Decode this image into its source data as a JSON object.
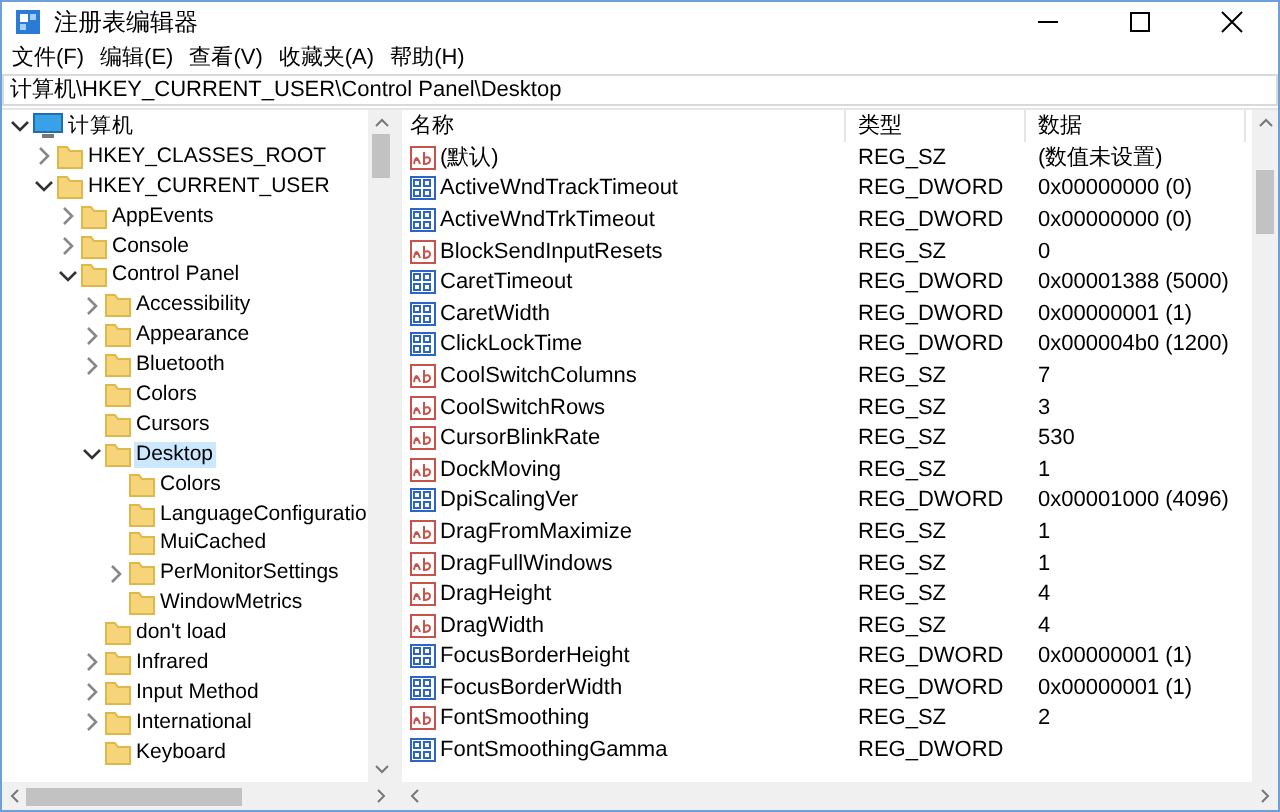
{
  "window": {
    "title": "注册表编辑器"
  },
  "menu": [
    "文件(F)",
    "编辑(E)",
    "查看(V)",
    "收藏夹(A)",
    "帮助(H)"
  ],
  "address": "计算机\\HKEY_CURRENT_USER\\Control Panel\\Desktop",
  "tree": [
    {
      "label": "计算机",
      "kind": "computer",
      "has_children": true,
      "expanded": true,
      "selected": false,
      "children": [
        {
          "label": "HKEY_CLASSES_ROOT",
          "kind": "folder",
          "has_children": true,
          "expanded": false,
          "selected": false
        },
        {
          "label": "HKEY_CURRENT_USER",
          "kind": "folder",
          "has_children": true,
          "expanded": true,
          "selected": false,
          "children": [
            {
              "label": "AppEvents",
              "kind": "folder",
              "has_children": true,
              "expanded": false,
              "selected": false
            },
            {
              "label": "Console",
              "kind": "folder",
              "has_children": true,
              "expanded": false,
              "selected": false
            },
            {
              "label": "Control Panel",
              "kind": "folder",
              "has_children": true,
              "expanded": true,
              "selected": false,
              "children": [
                {
                  "label": "Accessibility",
                  "kind": "folder",
                  "has_children": true,
                  "expanded": false,
                  "selected": false
                },
                {
                  "label": "Appearance",
                  "kind": "folder",
                  "has_children": true,
                  "expanded": false,
                  "selected": false
                },
                {
                  "label": "Bluetooth",
                  "kind": "folder",
                  "has_children": true,
                  "expanded": false,
                  "selected": false
                },
                {
                  "label": "Colors",
                  "kind": "folder",
                  "has_children": false,
                  "expanded": false,
                  "selected": false
                },
                {
                  "label": "Cursors",
                  "kind": "folder",
                  "has_children": false,
                  "expanded": false,
                  "selected": false
                },
                {
                  "label": "Desktop",
                  "kind": "folder",
                  "has_children": true,
                  "expanded": true,
                  "selected": true,
                  "children": [
                    {
                      "label": "Colors",
                      "kind": "folder",
                      "has_children": false,
                      "expanded": false,
                      "selected": false
                    },
                    {
                      "label": "LanguageConfiguratio",
                      "kind": "folder",
                      "has_children": false,
                      "expanded": false,
                      "selected": false
                    },
                    {
                      "label": "MuiCached",
                      "kind": "folder",
                      "has_children": false,
                      "expanded": false,
                      "selected": false
                    },
                    {
                      "label": "PerMonitorSettings",
                      "kind": "folder",
                      "has_children": true,
                      "expanded": false,
                      "selected": false
                    },
                    {
                      "label": "WindowMetrics",
                      "kind": "folder",
                      "has_children": false,
                      "expanded": false,
                      "selected": false
                    }
                  ]
                },
                {
                  "label": "don't load",
                  "kind": "folder",
                  "has_children": false,
                  "expanded": false,
                  "selected": false
                },
                {
                  "label": "Infrared",
                  "kind": "folder",
                  "has_children": true,
                  "expanded": false,
                  "selected": false
                },
                {
                  "label": "Input Method",
                  "kind": "folder",
                  "has_children": true,
                  "expanded": false,
                  "selected": false
                },
                {
                  "label": "International",
                  "kind": "folder",
                  "has_children": true,
                  "expanded": false,
                  "selected": false
                },
                {
                  "label": "Keyboard",
                  "kind": "folder",
                  "has_children": false,
                  "expanded": false,
                  "selected": false
                }
              ]
            }
          ]
        }
      ]
    }
  ],
  "table": {
    "columns": [
      "名称",
      "类型",
      "数据"
    ],
    "rows": [
      {
        "kind": "string",
        "name": "(默认)",
        "type": "REG_SZ",
        "data": "(数值未设置)"
      },
      {
        "kind": "dword",
        "name": "ActiveWndTrackTimeout",
        "type": "REG_DWORD",
        "data": "0x00000000 (0)"
      },
      {
        "kind": "dword",
        "name": "ActiveWndTrkTimeout",
        "type": "REG_DWORD",
        "data": "0x00000000 (0)"
      },
      {
        "kind": "string",
        "name": "BlockSendInputResets",
        "type": "REG_SZ",
        "data": "0"
      },
      {
        "kind": "dword",
        "name": "CaretTimeout",
        "type": "REG_DWORD",
        "data": "0x00001388 (5000)"
      },
      {
        "kind": "dword",
        "name": "CaretWidth",
        "type": "REG_DWORD",
        "data": "0x00000001 (1)"
      },
      {
        "kind": "dword",
        "name": "ClickLockTime",
        "type": "REG_DWORD",
        "data": "0x000004b0 (1200)"
      },
      {
        "kind": "string",
        "name": "CoolSwitchColumns",
        "type": "REG_SZ",
        "data": "7"
      },
      {
        "kind": "string",
        "name": "CoolSwitchRows",
        "type": "REG_SZ",
        "data": "3"
      },
      {
        "kind": "string",
        "name": "CursorBlinkRate",
        "type": "REG_SZ",
        "data": "530"
      },
      {
        "kind": "string",
        "name": "DockMoving",
        "type": "REG_SZ",
        "data": "1"
      },
      {
        "kind": "dword",
        "name": "DpiScalingVer",
        "type": "REG_DWORD",
        "data": "0x00001000 (4096)"
      },
      {
        "kind": "string",
        "name": "DragFromMaximize",
        "type": "REG_SZ",
        "data": "1"
      },
      {
        "kind": "string",
        "name": "DragFullWindows",
        "type": "REG_SZ",
        "data": "1"
      },
      {
        "kind": "string",
        "name": "DragHeight",
        "type": "REG_SZ",
        "data": "4"
      },
      {
        "kind": "string",
        "name": "DragWidth",
        "type": "REG_SZ",
        "data": "4"
      },
      {
        "kind": "dword",
        "name": "FocusBorderHeight",
        "type": "REG_DWORD",
        "data": "0x00000001 (1)"
      },
      {
        "kind": "dword",
        "name": "FocusBorderWidth",
        "type": "REG_DWORD",
        "data": "0x00000001 (1)"
      },
      {
        "kind": "string",
        "name": "FontSmoothing",
        "type": "REG_SZ",
        "data": "2"
      },
      {
        "kind": "dword",
        "name": "FontSmoothingGamma",
        "type": "REG_DWORD"
      }
    ]
  }
}
